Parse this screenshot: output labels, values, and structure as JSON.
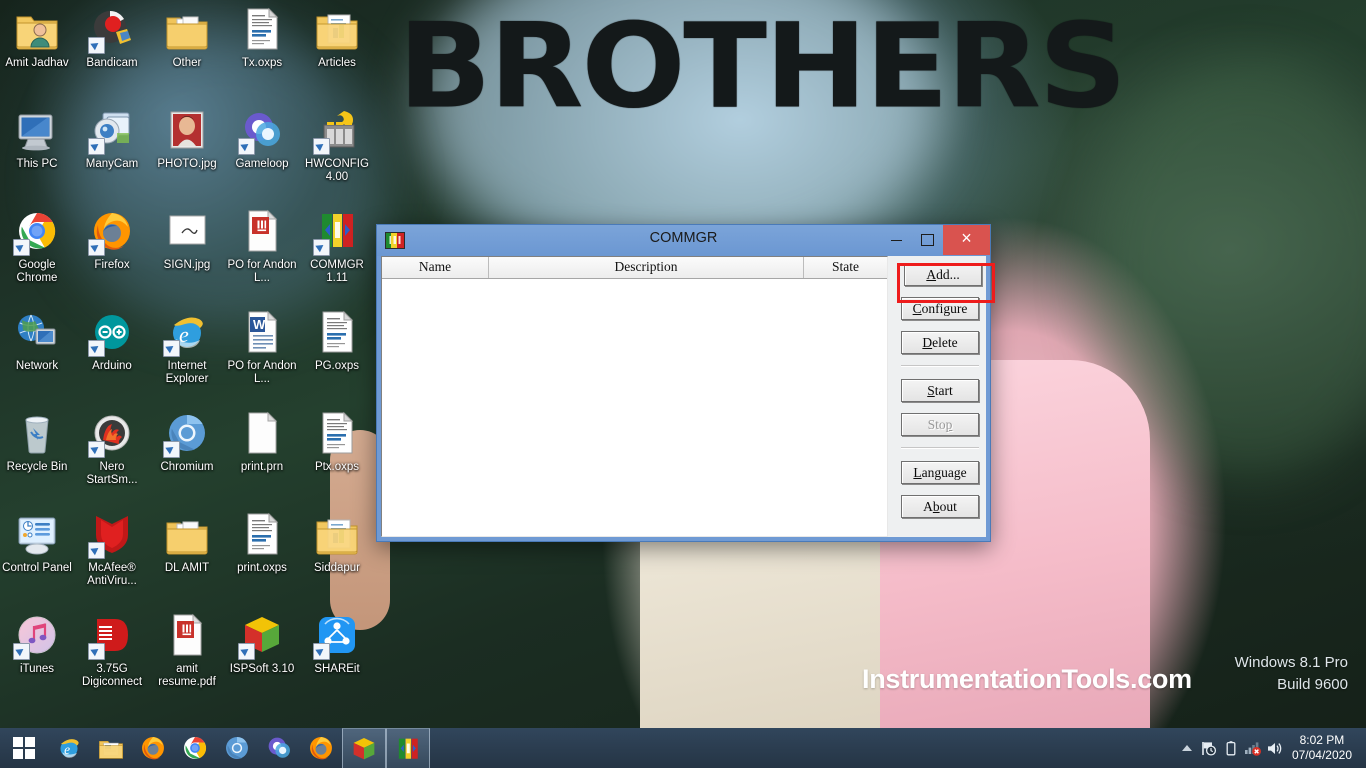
{
  "desktop": {
    "wallpaper_text": "BROTHERS",
    "site_watermark": "InstrumentationTools.com",
    "windows_watermark_line1": "Windows 8.1 Pro",
    "windows_watermark_line2": "Build 9600",
    "icons": [
      {
        "label": "Amit Jadhav",
        "icon": "folder-user-icon",
        "shortcut": false
      },
      {
        "label": "Bandicam",
        "icon": "bandicam-icon",
        "shortcut": true
      },
      {
        "label": "Other",
        "icon": "folder-icon",
        "shortcut": false
      },
      {
        "label": "Tx.oxps",
        "icon": "xps-document-icon",
        "shortcut": false
      },
      {
        "label": "Articles",
        "icon": "folder-docs-icon",
        "shortcut": false
      },
      {
        "label": "This PC",
        "icon": "computer-icon",
        "shortcut": false
      },
      {
        "label": "ManyCam",
        "icon": "manycam-icon",
        "shortcut": true
      },
      {
        "label": "PHOTO.jpg",
        "icon": "photo-icon",
        "shortcut": false
      },
      {
        "label": "Gameloop",
        "icon": "gameloop-icon",
        "shortcut": true
      },
      {
        "label": "HWCONFIG 4.00",
        "icon": "hwconfig-icon",
        "shortcut": true
      },
      {
        "label": "Google Chrome",
        "icon": "chrome-icon",
        "shortcut": true
      },
      {
        "label": "Firefox",
        "icon": "firefox-icon",
        "shortcut": true
      },
      {
        "label": "SIGN.jpg",
        "icon": "sign-image-icon",
        "shortcut": false
      },
      {
        "label": "PO for Andon L...",
        "icon": "pdf-document-icon",
        "shortcut": false
      },
      {
        "label": "COMMGR 1.11",
        "icon": "commgr-icon",
        "shortcut": true
      },
      {
        "label": "Network",
        "icon": "network-icon",
        "shortcut": false
      },
      {
        "label": "Arduino",
        "icon": "arduino-icon",
        "shortcut": true
      },
      {
        "label": "Internet Explorer",
        "icon": "internet-explorer-icon",
        "shortcut": true
      },
      {
        "label": "PO for Andon L...",
        "icon": "word-document-icon",
        "shortcut": false
      },
      {
        "label": "PG.oxps",
        "icon": "xps-document-icon",
        "shortcut": false
      },
      {
        "label": "Recycle Bin",
        "icon": "recycle-bin-icon",
        "shortcut": false
      },
      {
        "label": "Nero StartSm...",
        "icon": "nero-icon",
        "shortcut": true
      },
      {
        "label": "Chromium",
        "icon": "chromium-icon",
        "shortcut": true
      },
      {
        "label": "print.prn",
        "icon": "blank-file-icon",
        "shortcut": false
      },
      {
        "label": "Ptx.oxps",
        "icon": "xps-document-icon",
        "shortcut": false
      },
      {
        "label": "Control Panel",
        "icon": "control-panel-icon",
        "shortcut": false
      },
      {
        "label": "McAfee® AntiViru...",
        "icon": "mcafee-icon",
        "shortcut": true
      },
      {
        "label": "DL AMIT",
        "icon": "folder-icon",
        "shortcut": false
      },
      {
        "label": "print.oxps",
        "icon": "xps-document-icon",
        "shortcut": false
      },
      {
        "label": "Siddapur",
        "icon": "folder-docs-icon",
        "shortcut": false
      },
      {
        "label": "iTunes",
        "icon": "itunes-icon",
        "shortcut": true
      },
      {
        "label": "3.75G Digiconnect",
        "icon": "digiconnect-icon",
        "shortcut": true
      },
      {
        "label": "amit resume.pdf",
        "icon": "pdf-document-icon",
        "shortcut": false
      },
      {
        "label": "ISPSoft 3.10",
        "icon": "ispsoft-icon",
        "shortcut": true
      },
      {
        "label": "SHAREit",
        "icon": "shareit-icon",
        "shortcut": true
      }
    ]
  },
  "commgr_window": {
    "title": "COMMGR",
    "app_icon": "commgr-icon",
    "titlebar_buttons": {
      "minimize": "–",
      "maximize": "□",
      "close": "×"
    },
    "list": {
      "columns": [
        "Name",
        "Description",
        "State"
      ],
      "rows": []
    },
    "buttons": [
      {
        "id": "add",
        "label": "Add...",
        "accesskey": "A",
        "enabled": true,
        "focused": true,
        "highlighted": true
      },
      {
        "id": "configure",
        "label": "Configure",
        "accesskey": "C",
        "enabled": true,
        "focused": false,
        "highlighted": false
      },
      {
        "id": "delete",
        "label": "Delete",
        "accesskey": "D",
        "enabled": true,
        "focused": false,
        "highlighted": false
      },
      {
        "id": "start",
        "label": "Start",
        "accesskey": "S",
        "enabled": true,
        "focused": false,
        "highlighted": false
      },
      {
        "id": "stop",
        "label": "Stop",
        "accesskey": "p",
        "enabled": false,
        "focused": false,
        "highlighted": false
      },
      {
        "id": "language",
        "label": "Language",
        "accesskey": "L",
        "enabled": true,
        "focused": false,
        "highlighted": false
      },
      {
        "id": "about",
        "label": "About",
        "accesskey": "b",
        "enabled": true,
        "focused": false,
        "highlighted": false
      }
    ],
    "highlight_color": "#ee1c1c"
  },
  "taskbar": {
    "start_label": "Start",
    "pinned": [
      {
        "name": "internet-explorer-icon",
        "running": false
      },
      {
        "name": "file-explorer-icon",
        "running": false
      },
      {
        "name": "firefox-icon",
        "running": false
      },
      {
        "name": "chrome-icon",
        "running": false
      },
      {
        "name": "chromium-icon",
        "running": false
      },
      {
        "name": "gameloop-icon",
        "running": false
      },
      {
        "name": "firefox-alt-icon",
        "running": false
      },
      {
        "name": "ispsoft-icon",
        "running": true
      },
      {
        "name": "commgr-icon",
        "running": true
      }
    ],
    "tray": {
      "show_hidden_icons": "show-hidden-icons-chevron",
      "icons": [
        "flag-action-center-icon",
        "battery-icon",
        "network-error-icon",
        "volume-icon"
      ],
      "time": "8:02 PM",
      "date": "07/04/2020"
    }
  }
}
